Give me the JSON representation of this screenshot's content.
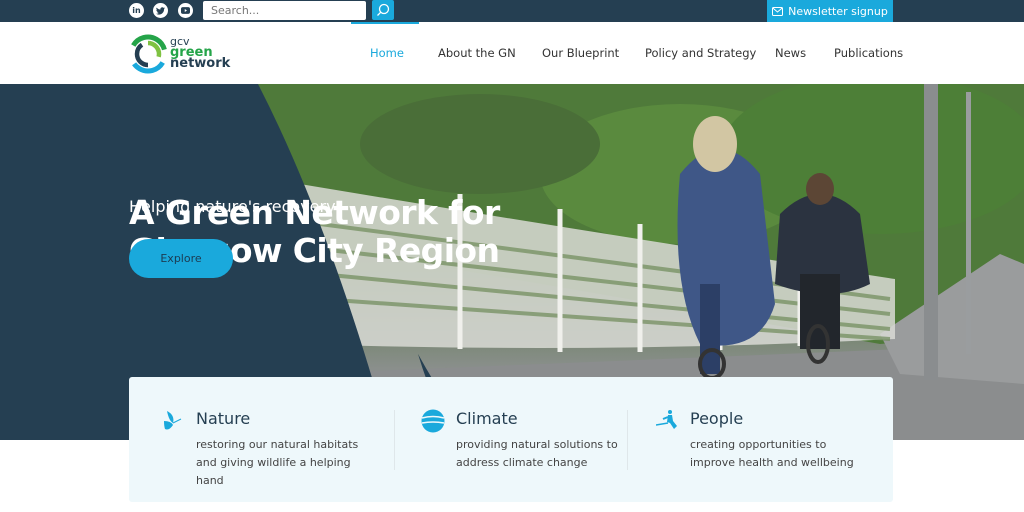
{
  "topbar": {
    "social": [
      {
        "name": "linkedin",
        "glyph": "in"
      },
      {
        "name": "twitter",
        "glyph": "t"
      },
      {
        "name": "youtube",
        "glyph": "▶"
      }
    ],
    "search_placeholder": "Search...",
    "newsletter_label": "Newsletter signup"
  },
  "logo": {
    "line1": "gcv",
    "line2": "green",
    "line3": "network"
  },
  "nav": {
    "items": [
      {
        "label": "Home",
        "active": true
      },
      {
        "label": "About the GN"
      },
      {
        "label": "Our Blueprint"
      },
      {
        "label": "Policy and Strategy"
      },
      {
        "label": "News"
      },
      {
        "label": "Publications"
      }
    ]
  },
  "hero": {
    "title_line1": "A Green Network for",
    "title_line2": "Glasgow City Region",
    "subtitle": "Helping nature's recovery",
    "cta_label": "Explore"
  },
  "cards": [
    {
      "icon": "butterfly-icon",
      "title": "Nature",
      "desc": "restoring our natural habitats and giving wildlife a helping hand"
    },
    {
      "icon": "globe-icon",
      "title": "Climate",
      "desc": "providing natural solutions to address climate change"
    },
    {
      "icon": "runner-icon",
      "title": "People",
      "desc": "creating opportunities to improve health and wellbeing"
    }
  ],
  "colors": {
    "navy": "#253f52",
    "accent": "#1aa9dc",
    "green": "#25a449",
    "card_bg": "#eef8fb"
  }
}
